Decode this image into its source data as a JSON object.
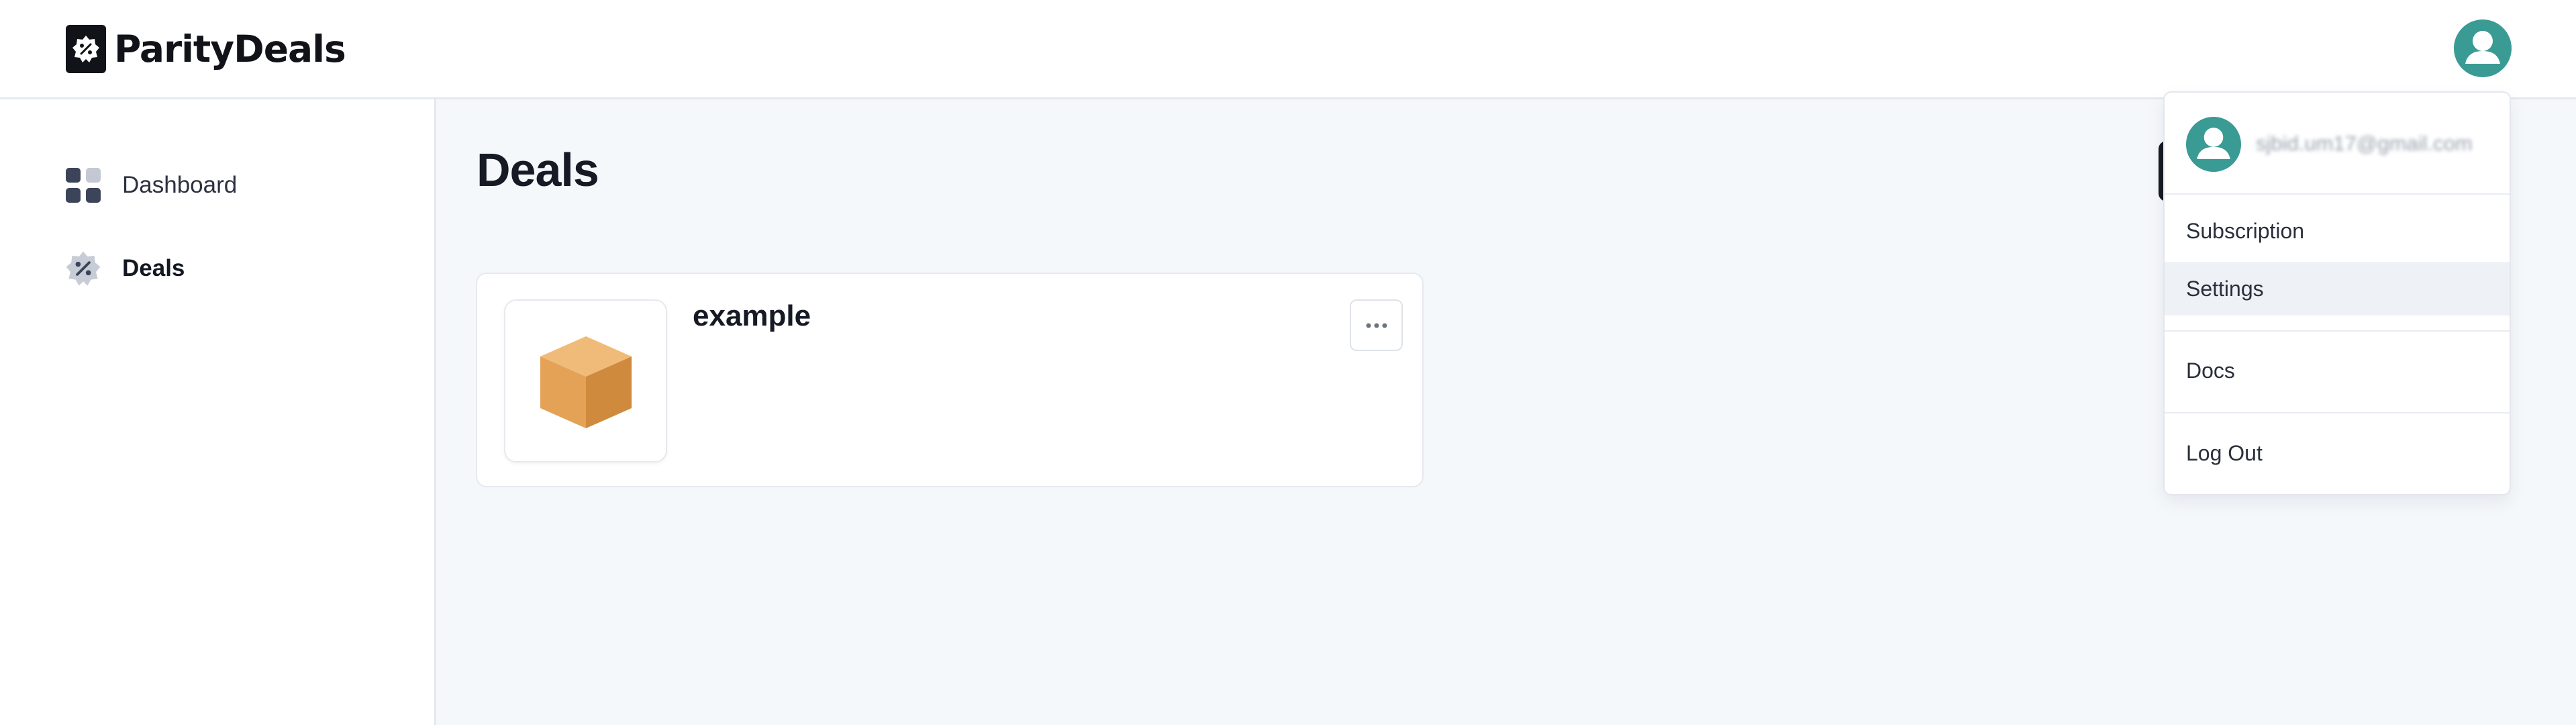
{
  "brand": {
    "name": "ParityDeals"
  },
  "sidebar": {
    "items": [
      {
        "label": "Dashboard",
        "icon": "dashboard-grid-icon",
        "active": false
      },
      {
        "label": "Deals",
        "icon": "discount-badge-icon",
        "active": true
      }
    ]
  },
  "main": {
    "title": "Deals",
    "deals": [
      {
        "name": "example",
        "icon": "package-box-icon"
      }
    ]
  },
  "user_menu": {
    "email": "sjbid.um17@gmail.com",
    "items": [
      "Subscription",
      "Settings",
      "Docs",
      "Log Out"
    ]
  },
  "colors": {
    "accent_teal": "#3a9a94",
    "box_orange": "#e4a257",
    "text_dark": "#161a24"
  }
}
